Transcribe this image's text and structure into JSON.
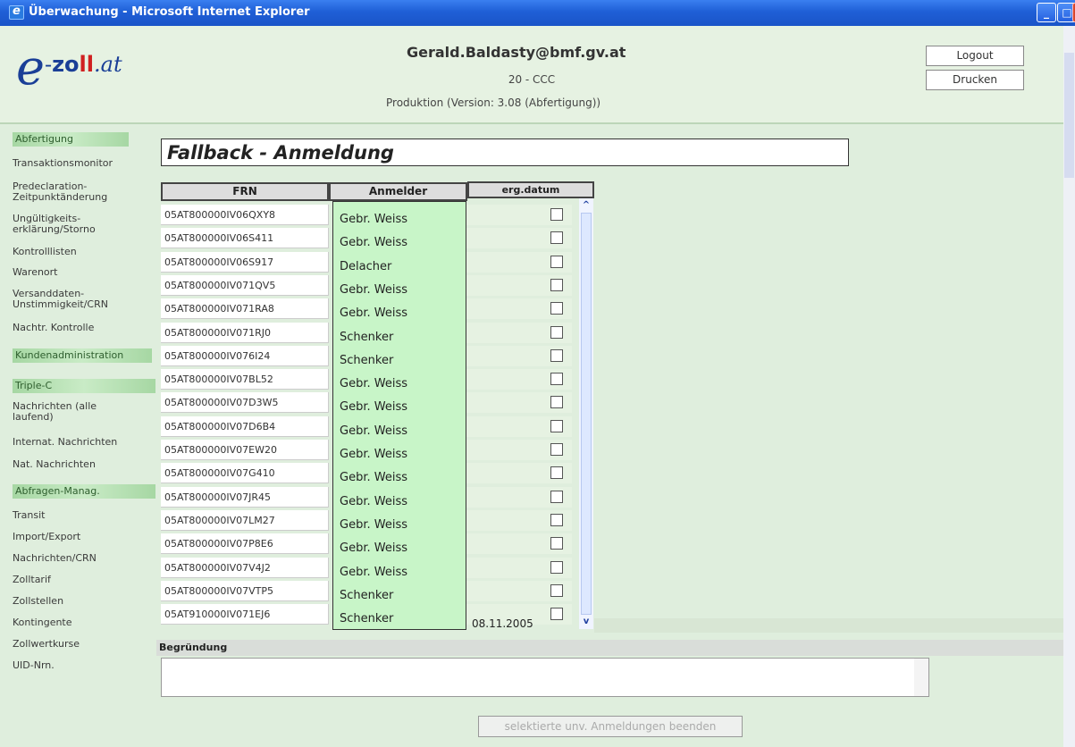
{
  "window": {
    "title": "Überwachung - Microsoft Internet Explorer",
    "buttons": [
      "minimize",
      "maximize",
      "close"
    ]
  },
  "header": {
    "logo": {
      "e": "e",
      "dash": "-",
      "zo": "zo",
      "ll": "ll",
      "at": ".at"
    },
    "user_email": "Gerald.Baldasty@bmf.gv.at",
    "sub": "20 - CCC",
    "production": "Produktion (Version: 3.08 (Abfertigung))",
    "logout_label": "Logout",
    "print_label": "Drucken"
  },
  "sidebar": {
    "items": [
      {
        "label": "Abfertigung",
        "type": "head"
      },
      {
        "label": "Transaktionsmonitor",
        "type": "link"
      },
      {
        "label": "Predeclaration-\nZeitpunktänderung",
        "type": "link"
      },
      {
        "label": "Ungültigkeits-\nerklärung/Storno",
        "type": "link"
      },
      {
        "label": "Kontrolllisten",
        "type": "link"
      },
      {
        "label": "Warenort",
        "type": "link"
      },
      {
        "label": "Versanddaten-\nUnstimmigkeit/CRN",
        "type": "link"
      },
      {
        "label": "Nachtr. Kontrolle",
        "type": "link"
      },
      {
        "label": "Kundenadministration",
        "type": "head"
      },
      {
        "label": "Triple-C",
        "type": "head"
      },
      {
        "label": "Nachrichten (alle\nlaufend)",
        "type": "link"
      },
      {
        "label": "Internat. Nachrichten",
        "type": "link"
      },
      {
        "label": "Nat. Nachrichten",
        "type": "link"
      },
      {
        "label": "Abfragen-Manag.",
        "type": "head"
      },
      {
        "label": "Transit",
        "type": "link"
      },
      {
        "label": "Import/Export",
        "type": "link"
      },
      {
        "label": "Nachrichten/CRN",
        "type": "link"
      },
      {
        "label": "Zolltarif",
        "type": "link"
      },
      {
        "label": "Zollstellen",
        "type": "link"
      },
      {
        "label": "Kontingente",
        "type": "link"
      },
      {
        "label": "Zollwertkurse",
        "type": "link"
      },
      {
        "label": "UID-Nrn.",
        "type": "link"
      }
    ]
  },
  "main": {
    "title": "Fallback - Anmeldung",
    "columns": {
      "frn": "FRN",
      "anmelder": "Anmelder",
      "erg": "erg.datum"
    },
    "rows": [
      "05AT800000IV06QXY8",
      "05AT800000IV06S411",
      "05AT800000IV06S917",
      "05AT800000IV071QV5",
      "05AT800000IV071RA8",
      "05AT800000IV071RJ0",
      "05AT800000IV076I24",
      "05AT800000IV07BL52",
      "05AT800000IV07D3W5",
      "05AT800000IV07D6B4",
      "05AT800000IV07EW20",
      "05AT800000IV07G410",
      "05AT800000IV07JR45",
      "05AT800000IV07LM27",
      "05AT800000IV07P8E6",
      "05AT800000IV07V4J2",
      "05AT800000IV07VTP5",
      "05AT910000IV071EJ6"
    ],
    "last_row_date": "08.11.2005",
    "dropdown_options": [
      "Gebr. Weiss",
      "Gebr. Weiss",
      "Delacher",
      "Gebr. Weiss",
      "Gebr. Weiss",
      "Schenker",
      "Schenker",
      "Gebr. Weiss",
      "Gebr. Weiss",
      "Gebr. Weiss",
      "Gebr. Weiss",
      "Gebr. Weiss",
      "Gebr. Weiss",
      "Gebr. Weiss",
      "Gebr. Weiss",
      "Gebr. Weiss",
      "Schenker",
      "Schenker"
    ],
    "grund_label": "Begründung",
    "submit_label": "selektierte unv. Anmeldungen beenden"
  }
}
